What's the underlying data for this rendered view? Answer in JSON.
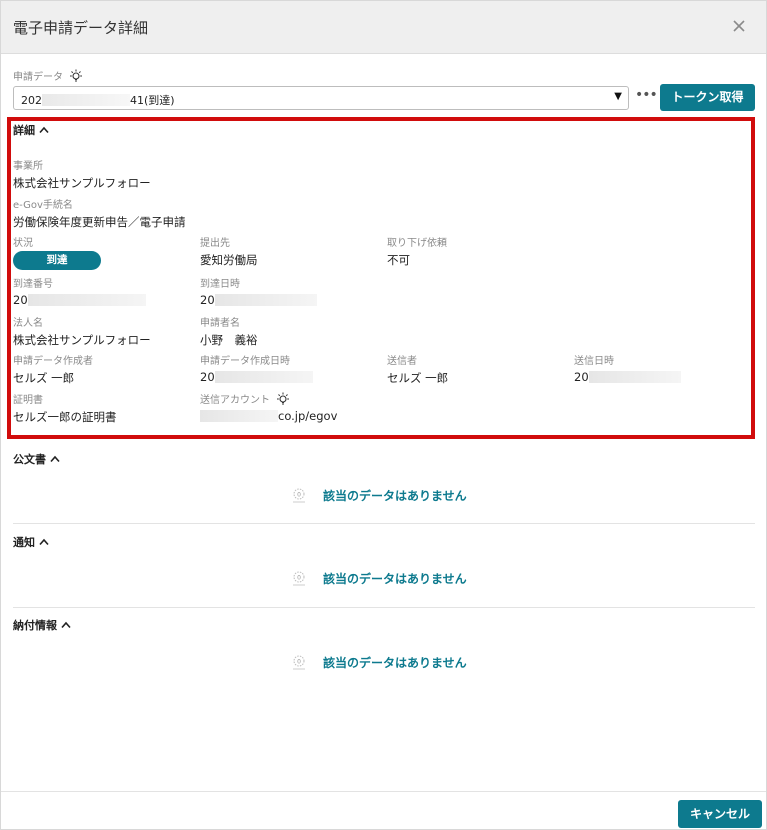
{
  "dialog": {
    "title": "電子申請データ詳細"
  },
  "selector": {
    "label": "申請データ",
    "value_prefix": "202",
    "value_suffix": "41(到達)",
    "more_label": "•••",
    "token_button": "トークン取得"
  },
  "detail": {
    "heading": "詳細",
    "office_label": "事業所",
    "office_value": "株式会社サンプルフォロー",
    "procedure_label": "e-Gov手続名",
    "procedure_value": "労働保険年度更新申告／電子申請",
    "status_label": "状況",
    "status_value": "到達",
    "submit_to_label": "提出先",
    "submit_to_value": "愛知労働局",
    "withdraw_label": "取り下げ依頼",
    "withdraw_value": "不可",
    "arrival_no_label": "到達番号",
    "arrival_no_value": "20",
    "arrival_date_label": "到達日時",
    "arrival_date_value": "20",
    "corp_label": "法人名",
    "corp_value": "株式会社サンプルフォロー",
    "applicant_label": "申請者名",
    "applicant_value": "小野　義裕",
    "creator_label": "申請データ作成者",
    "creator_value": "セルズ 一郎",
    "created_at_label": "申請データ作成日時",
    "created_at_value": "20",
    "sender_label": "送信者",
    "sender_value": "セルズ 一郎",
    "sent_at_label": "送信日時",
    "sent_at_value": "20",
    "cert_label": "証明書",
    "cert_value": "セルズ一郎の証明書",
    "account_label": "送信アカウント",
    "account_value": "co.jp/egov"
  },
  "sections": {
    "official_docs": "公文書",
    "notices": "通知",
    "payment_info": "納付情報",
    "empty_message": "該当のデータはありません"
  },
  "footer": {
    "cancel_button": "キャンセル"
  },
  "colors": {
    "accent": "#0d7a8e",
    "highlight_border": "#d10c0c"
  }
}
